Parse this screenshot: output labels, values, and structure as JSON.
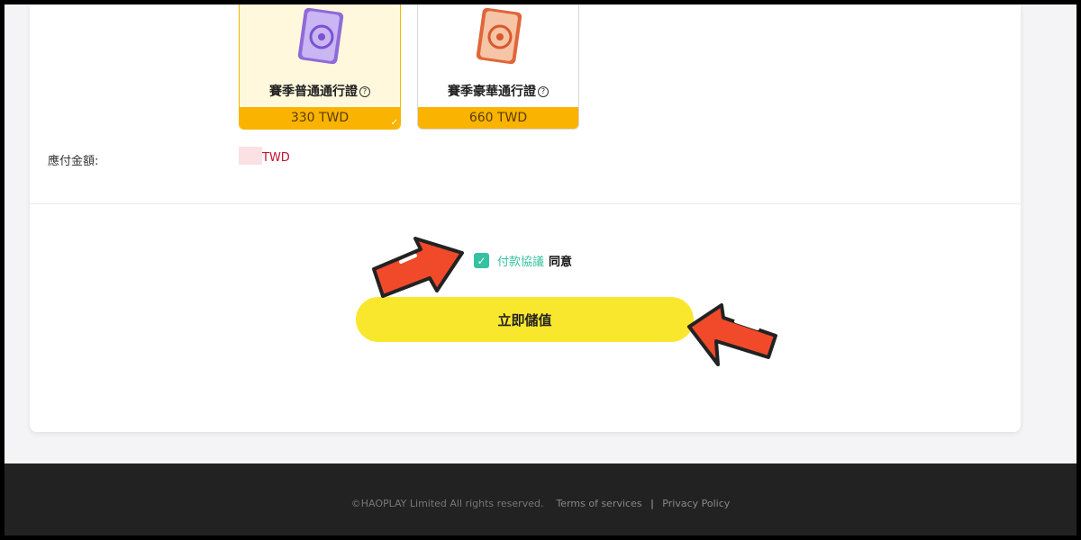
{
  "passes": [
    {
      "name": "賽季普通通行證",
      "price": "330 TWD",
      "selected": true,
      "color": "#8f6ad8",
      "icon": "pass-book-icon"
    },
    {
      "name": "賽季豪華通行證",
      "price": "660 TWD",
      "selected": false,
      "color": "#f08a4b",
      "icon": "pass-book-icon"
    }
  ],
  "amount": {
    "label": "應付金額:",
    "currency": "TWD"
  },
  "agreement": {
    "link_text": "付款協議",
    "agree_text": "同意",
    "checked": true
  },
  "pay_button": {
    "label": "立即儲值"
  },
  "footer": {
    "copyright": "©HAOPLAY Limited All rights reserved.",
    "terms": "Terms of services",
    "separator": "|",
    "privacy": "Privacy Policy"
  },
  "colors": {
    "accent_yellow": "#f9e72d",
    "price_bar": "#f9b300",
    "teal": "#35c2a0",
    "currency_red": "#c8102e",
    "arrow_red": "#f04a2a"
  }
}
